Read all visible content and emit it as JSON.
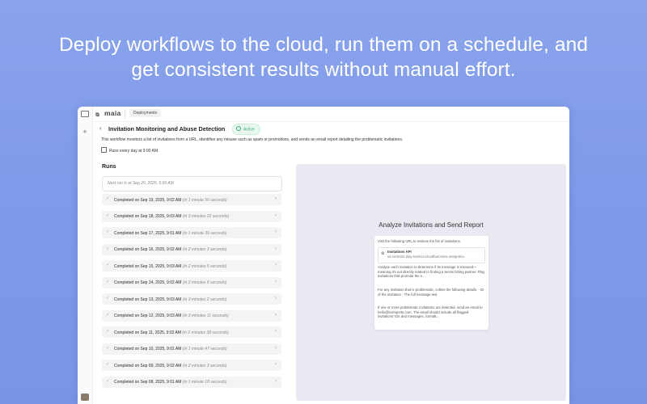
{
  "headline": {
    "line1": "Deploy workflows to the cloud, run them on a schedule, and",
    "line2": "get consistent results without manual effort."
  },
  "app": {
    "brand": "maia",
    "breadcrumb": "Deployments"
  },
  "workflow": {
    "title": "Invitation Monitoring and Abuse Detection",
    "status": "Active",
    "description": "This workflow monitors a list of invitations from a URL, identifies any misuse such as spam or promotions, and sends an email report detailing the problematic invitations.",
    "schedule": "Runs every day at 9:00 AM."
  },
  "runs": {
    "title": "Runs",
    "next_run": "Next run is at Sep 20, 2025, 9:00 AM",
    "items": [
      {
        "label": "Completed on Sep 19, 2025, 9:02 AM",
        "duration": "(in 1 minute 56 seconds)"
      },
      {
        "label": "Completed on Sep 18, 2025, 9:03 AM",
        "duration": "(in 3 minutes 22 seconds)"
      },
      {
        "label": "Completed on Sep 17, 2025, 9:01 AM",
        "duration": "(in 1 minute 39 seconds)"
      },
      {
        "label": "Completed on Sep 16, 2025, 9:02 AM",
        "duration": "(in 2 minutes 3 seconds)"
      },
      {
        "label": "Completed on Sep 15, 2025, 9:03 AM",
        "duration": "(in 2 minutes 5 seconds)"
      },
      {
        "label": "Completed on Sep 14, 2025, 9:02 AM",
        "duration": "(in 2 minutes 8 seconds)"
      },
      {
        "label": "Completed on Sep 13, 2025, 9:03 AM",
        "duration": "(in 3 minutes 2 seconds)"
      },
      {
        "label": "Completed on Sep 12, 2025, 9:03 AM",
        "duration": "(in 3 minutes 11 seconds)"
      },
      {
        "label": "Completed on Sep 11, 2025, 9:02 AM",
        "duration": "(in 2 minutes 38 seconds)"
      },
      {
        "label": "Completed on Sep 10, 2025, 9:01 AM",
        "duration": "(in 1 minute 47 seconds)"
      },
      {
        "label": "Completed on Sep 09, 2025, 9:02 AM",
        "duration": "(in 2 minutes 3 seconds)"
      },
      {
        "label": "Completed on Sep 08, 2025, 9:01 AM",
        "duration": "(in 1 minute 18 seconds)"
      }
    ]
  },
  "preview": {
    "title": "Analyze Invitations and Send Report",
    "intro": "Visit the following URL to retrieve the list of invitations.",
    "api_name": "Invitations API",
    "api_url": "us-central1-play-tennis4.cloudfunctions.net/getInv...",
    "para1": "Analyze each invitation to determine if its message is misused—meaning it's not directly related to finding a tennis hitting partner. Flag invitations that promote the s...",
    "para2": "For any invitation that is problematic, collect the following details: - ID of the invitation - The full message text",
    "para3": "If one or more problematic invitations are detected, send an email to hello@kortsports.com. The email should include all flagged invitations' IDs and messages, formatt..."
  },
  "colors": {
    "background": "#7f9ae8",
    "active_status": "#3ca86a"
  }
}
